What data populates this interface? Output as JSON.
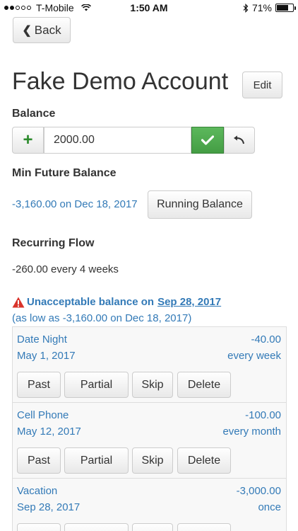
{
  "status_bar": {
    "carrier": "T-Mobile",
    "time": "1:50 AM",
    "battery": "71%",
    "battery_level": 0.71
  },
  "nav": {
    "back_label": "Back"
  },
  "account": {
    "title": "Fake Demo Account",
    "edit_label": "Edit"
  },
  "balance": {
    "label": "Balance",
    "value": "2000.00"
  },
  "min_future": {
    "label": "Min Future Balance",
    "value": "-3,160.00 on Dec 18, 2017",
    "running_balance_label": "Running Balance"
  },
  "recurring": {
    "label": "Recurring Flow",
    "value": "-260.00 every 4 weeks"
  },
  "warning": {
    "text": "Unacceptable balance on",
    "date": "Sep 28, 2017",
    "detail": "(as low as -3,160.00 on Dec 18, 2017)"
  },
  "flow_actions": {
    "past": "Past",
    "partial": "Partial",
    "skip": "Skip",
    "delete": "Delete"
  },
  "flows": [
    {
      "name": "Date Night",
      "date": "May 1, 2017",
      "amount": "-40.00",
      "frequency": "every week"
    },
    {
      "name": "Cell Phone",
      "date": "May 12, 2017",
      "amount": "-100.00",
      "frequency": "every month"
    },
    {
      "name": "Vacation",
      "date": "Sep 28, 2017",
      "amount": "-3,000.00",
      "frequency": "once"
    }
  ]
}
